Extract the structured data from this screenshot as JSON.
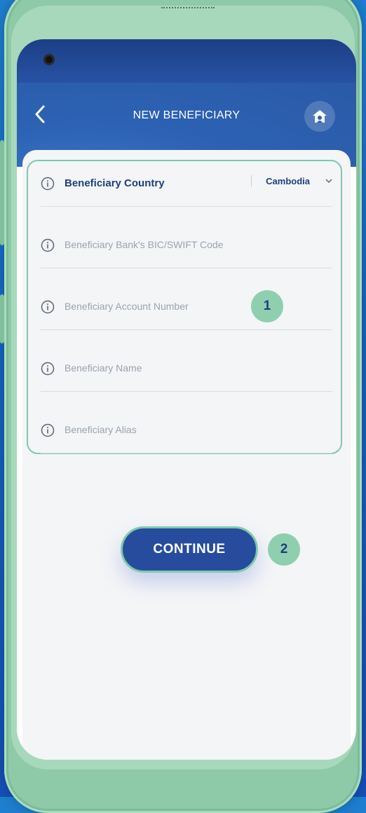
{
  "header": {
    "title": "NEW BENEFICIARY"
  },
  "form": {
    "fields": [
      {
        "label": "Beneficiary Country",
        "value": "Cambodia"
      },
      {
        "label": "Beneficiary Bank's BIC/SWIFT Code"
      },
      {
        "label": "Beneficiary Account Number"
      },
      {
        "label": "Beneficiary Name"
      },
      {
        "label": "Beneficiary Alias"
      }
    ]
  },
  "actions": {
    "continue_label": "CONTINUE"
  },
  "annotations": {
    "badge_1": "1",
    "badge_2": "2"
  },
  "colors": {
    "primary": "#274c9d",
    "accent": "#7ec9aa",
    "frame": "#8ec9a8"
  },
  "icons": {
    "back": "chevron-left-icon",
    "home": "home-icon",
    "info": "info-icon",
    "dropdown": "chevron-down-icon"
  }
}
